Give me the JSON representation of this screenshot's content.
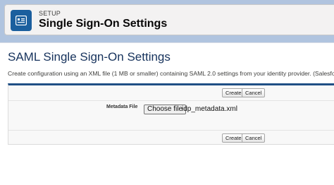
{
  "header": {
    "eyebrow": "SETUP",
    "title": "Single Sign-On Settings",
    "icon": "setup-icon"
  },
  "main": {
    "section_title": "SAML Single Sign-On Settings",
    "description": "Create configuration using an XML file (1 MB or smaller) containing SAML 2.0 settings from your identity provider. (Salesforce doesn't st",
    "buttons_top": {
      "create": "Create",
      "cancel": "Cancel"
    },
    "metadata_field": {
      "label": "Metadata File",
      "choose_button": "Choose file",
      "file_name": "idp_metadata.xml"
    },
    "buttons_bottom": {
      "create": "Create",
      "cancel": "Cancel"
    }
  },
  "colors": {
    "header_icon_bg": "#1b5f9e",
    "form_accent": "#1f4f85",
    "page_bg": "#b0c4df"
  }
}
